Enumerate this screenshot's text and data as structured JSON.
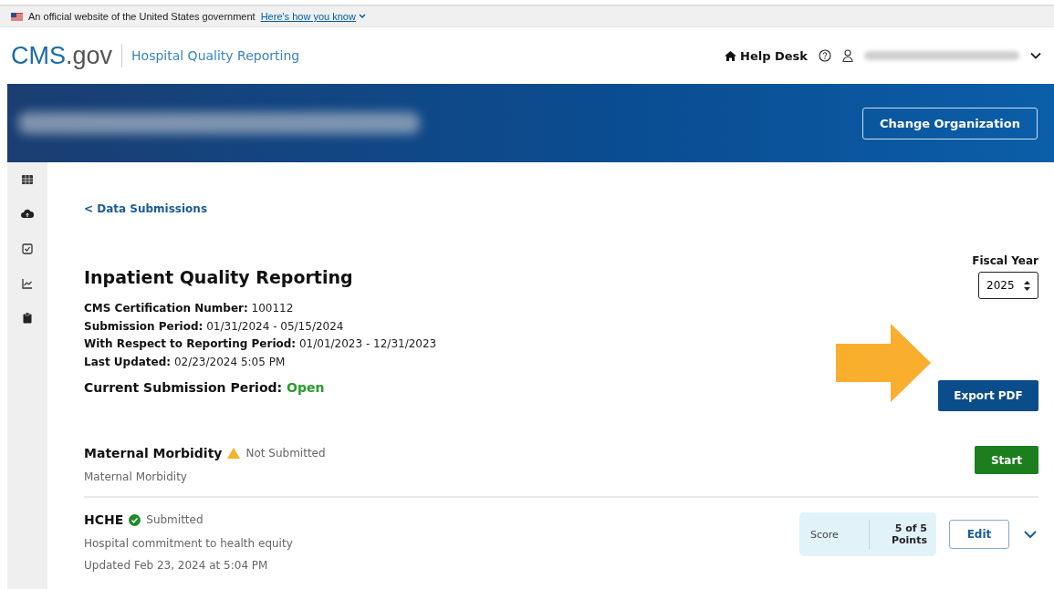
{
  "gov_banner": {
    "text": "An official website of the United States government",
    "link": "Here's how you know"
  },
  "header": {
    "logo_main": "CMS",
    "logo_suffix": ".gov",
    "app_name": "Hospital Quality Reporting",
    "help_desk": "Help Desk"
  },
  "org_band": {
    "button": "Change Organization"
  },
  "back_link": "< Data Submissions",
  "title": "Inpatient Quality Reporting",
  "fiscal_year": {
    "label": "Fiscal Year",
    "value": "2025"
  },
  "details": [
    {
      "label": "CMS Certification Number:",
      "value": "100112"
    },
    {
      "label": "Submission Period:",
      "value": "01/31/2024 - 05/15/2024"
    },
    {
      "label": "With Respect to Reporting Period:",
      "value": "01/01/2023 - 12/31/2023"
    },
    {
      "label": "Last Updated:",
      "value": "02/23/2024 5:05 PM"
    }
  ],
  "current_period": {
    "label": "Current Submission Period:",
    "value": "Open"
  },
  "export_button": "Export PDF",
  "measures": [
    {
      "name": "Maternal Morbidity",
      "status": "Not Submitted",
      "kind": "warning",
      "description": "Maternal Morbidity",
      "action": "Start"
    },
    {
      "name": "HCHE",
      "status": "Submitted",
      "kind": "success",
      "description": "Hospital commitment to health equity",
      "updated": "Updated Feb 23, 2024 at 5:04 PM",
      "score_label": "Score",
      "score_value": "5 of 5 Points",
      "action": "Edit",
      "expanded": false
    }
  ]
}
